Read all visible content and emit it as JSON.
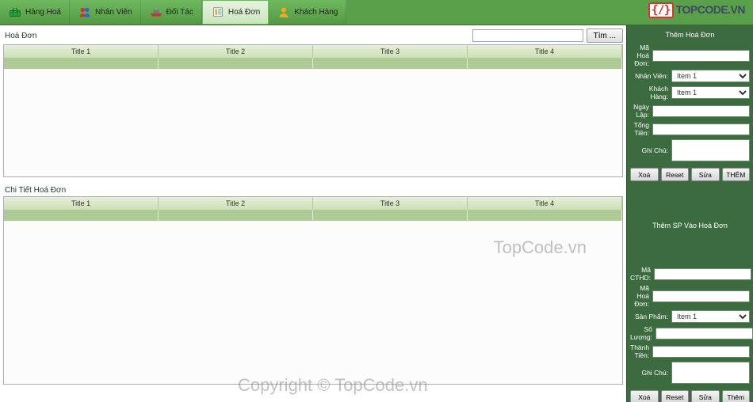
{
  "toolbar": {
    "items": [
      {
        "label": "Hàng Hoá",
        "active": false
      },
      {
        "label": "Nhân Viên",
        "active": false
      },
      {
        "label": "Đối Tác",
        "active": false
      },
      {
        "label": "Hoá Đơn",
        "active": true
      },
      {
        "label": "Khách Hàng",
        "active": false
      }
    ]
  },
  "logo": {
    "brace": "{/}",
    "text": "TOPCODE.VN"
  },
  "search": {
    "placeholder": "",
    "button": "Tìm ..."
  },
  "section1": {
    "title": "Hoá Đơn",
    "columns": [
      "Title 1",
      "Title 2",
      "Title 3",
      "Title 4"
    ]
  },
  "section2": {
    "title": "Chi Tiết Hoá Đơn",
    "columns": [
      "Title 1",
      "Title 2",
      "Title 3",
      "Title 4"
    ]
  },
  "form1": {
    "title": "Thêm Hoá Đơn",
    "fields": {
      "ma_hoa_don": {
        "label": "Mã Hoá Đơn:",
        "value": ""
      },
      "nhan_vien": {
        "label": "Nhân Viên:",
        "value": "Item 1",
        "options": [
          "Item 1"
        ]
      },
      "khach_hang": {
        "label": "Khách Hàng:",
        "value": "Item 1",
        "options": [
          "Item 1"
        ]
      },
      "ngay_lap": {
        "label": "Ngày Lập:",
        "value": ""
      },
      "tong_tien": {
        "label": "Tổng Tiền:",
        "value": ""
      },
      "ghi_chu": {
        "label": "Ghi Chú:",
        "value": ""
      }
    },
    "buttons": {
      "xoa": "Xoá",
      "reset": "Reset",
      "sua": "Sửa",
      "them": "THÊM"
    }
  },
  "form2": {
    "title": "Thêm SP Vào Hoá Đơn",
    "fields": {
      "ma_cthd": {
        "label": "Mã CTHD:",
        "value": ""
      },
      "ma_hoa_don": {
        "label": "Mã Hoá Đơn:",
        "value": ""
      },
      "san_pham": {
        "label": "Sản Phẩm:",
        "value": "Item 1",
        "options": [
          "Item 1"
        ]
      },
      "so_luong": {
        "label": "Số Lượng:",
        "value": ""
      },
      "thanh_tien": {
        "label": "Thành Tiền:",
        "value": ""
      },
      "ghi_chu": {
        "label": "Ghi Chú:",
        "value": ""
      }
    },
    "buttons": {
      "xoa": "Xoá",
      "reset": "Reset",
      "sua": "Sửa",
      "them": "Thêm"
    }
  },
  "watermark": {
    "w1": "TopCode.vn",
    "w2": "Copyright © TopCode.vn"
  }
}
